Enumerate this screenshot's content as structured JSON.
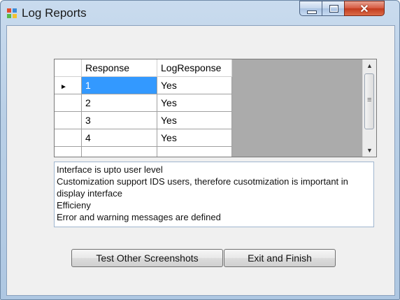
{
  "window": {
    "title": "Log Reports",
    "icon": "windows-form-icon",
    "controls": {
      "minimize": "minimize-icon",
      "maximize": "maximize-icon",
      "close": "close-icon"
    }
  },
  "grid": {
    "columns": [
      "Response",
      "LogResponse"
    ],
    "rows": [
      {
        "response": "1",
        "log_response": "Yes"
      },
      {
        "response": "2",
        "log_response": "Yes"
      },
      {
        "response": "3",
        "log_response": "Yes"
      },
      {
        "response": "4",
        "log_response": "Yes"
      }
    ],
    "current_row_marker": "►",
    "new_row_marker": "*",
    "selected_color": "#3399ff"
  },
  "notes": {
    "lines": [
      "Interface is upto user level",
      "Customization support IDS users, therefore cusotmization is important in display interface",
      "Efficieny",
      "Error and warning messages are defined"
    ]
  },
  "buttons": {
    "test_label": "Test Other Screenshots",
    "exit_label": "Exit and Finish"
  }
}
